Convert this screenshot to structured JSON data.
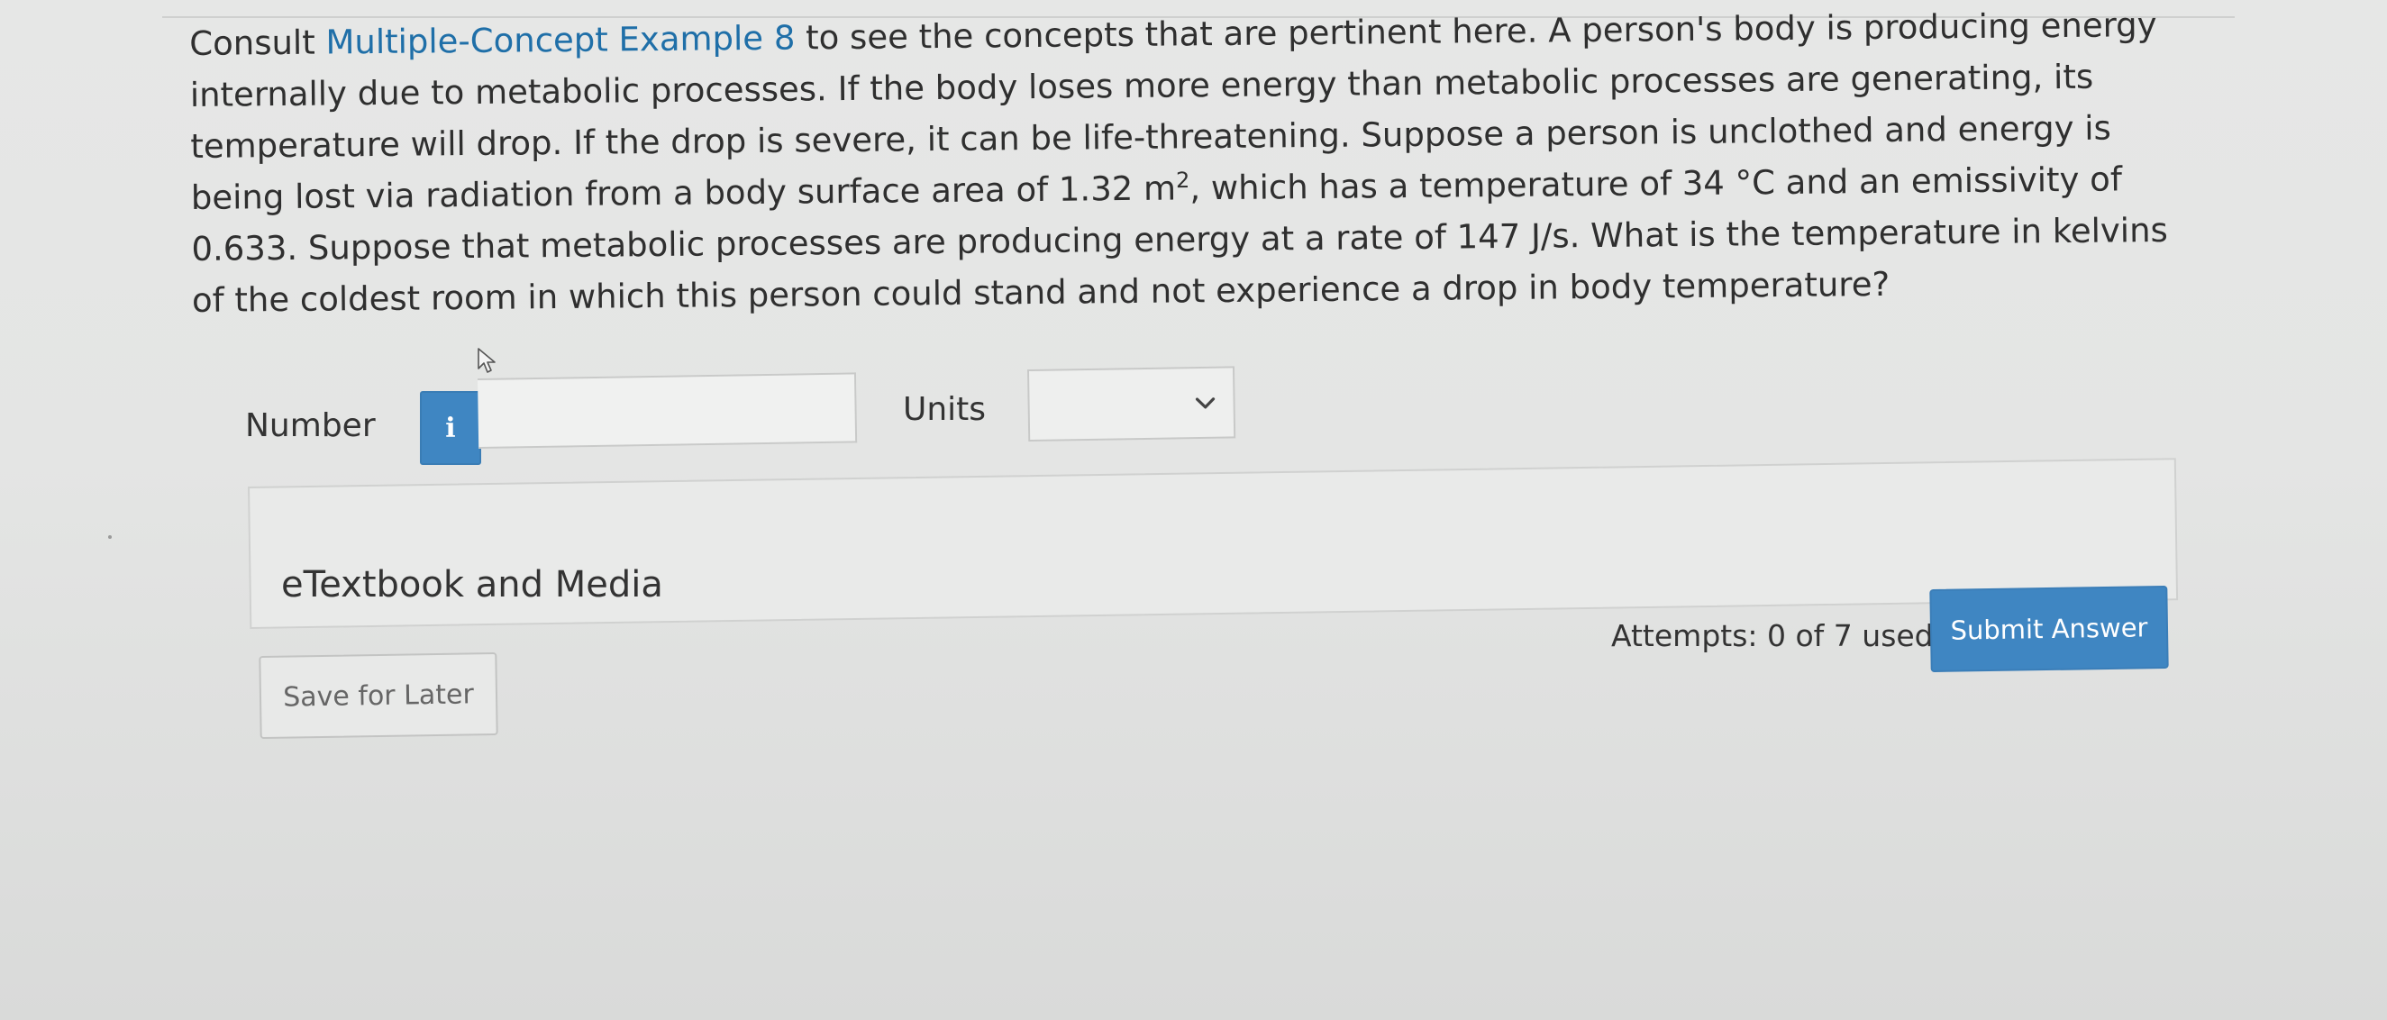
{
  "question": {
    "before_link": "Consult ",
    "link": "Multiple-Concept Example 8",
    "after_link": " to see the concepts that are pertinent here. A person's body is producing energy internally due to metabolic processes. If the body loses more energy than metabolic processes are generating, its temperature will drop. If the drop is severe, it can be life-threatening. Suppose a person is unclothed and energy is being lost via radiation from a body surface area of 1.32 m",
    "superscript": "2",
    "after_sup": ", which has a temperature of 34 °C and an emissivity of 0.633. Suppose that metabolic processes are producing energy at a rate of 147 J/s. What is the temperature in kelvins of the coldest room in which this person could stand and not experience a drop in body temperature?"
  },
  "answer": {
    "number_label": "Number",
    "info_icon": "i",
    "number_value": "",
    "units_label": "Units",
    "units_value": ""
  },
  "resources": {
    "etextbook_label": "eTextbook and Media"
  },
  "footer": {
    "attempts_text": "Attempts: 0 of 7 used",
    "submit_label": "Submit Answer",
    "save_label": "Save for Later"
  },
  "icons": {
    "info": "info-icon",
    "chevron": "chevron-down-icon",
    "cursor": "mouse-pointer-icon"
  },
  "colors": {
    "accent": "#3f86c2",
    "link": "#1f6fa8",
    "background": "#e6e7e6"
  }
}
